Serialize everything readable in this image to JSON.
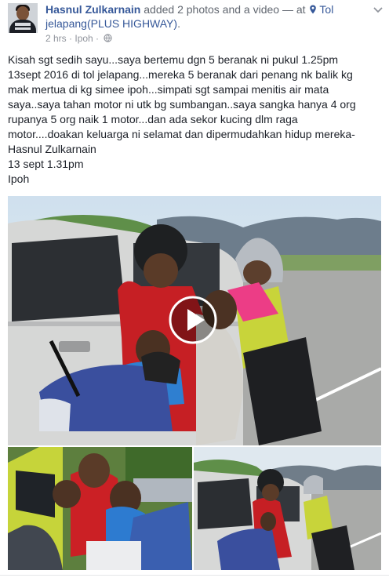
{
  "author": {
    "name": "Hasnul Zulkarnain",
    "action": " added 2 photos and a video — at ",
    "place": "Tol jelapang(PLUS HIGHWAY)",
    "place_suffix": "."
  },
  "meta": {
    "time": "2 hrs",
    "separator": " · ",
    "location": "Ipoh",
    "privacy_icon": "globe-icon"
  },
  "post_text_lines": [
    "Kisah sgt sedih sayu...saya bertemu dgn 5 beranak ni pukul 1.25pm",
    "13sept 2016 di tol jelapang...mereka 5 beranak dari penang nk balik kg",
    "mak mertua di kg simee ipoh...simpati sgt sampai menitis air mata",
    "saya..saya tahan motor ni utk bg sumbangan..saya sangka hanya 4 org",
    "rupanya 5 org naik 1 motor...dan ada sekor kucing dlm raga",
    "motor....doakan keluarga ni selamat dan dipermudahkan hidup mereka-",
    "Hasnul Zulkarnain",
    "13 sept 1.31pm",
    "Ipoh"
  ],
  "media": {
    "main": "video",
    "thumbnails": [
      "photo",
      "photo"
    ],
    "play_icon": "play-icon"
  },
  "colors": {
    "link": "#365899",
    "meta": "#90949c",
    "text": "#1d2129"
  }
}
